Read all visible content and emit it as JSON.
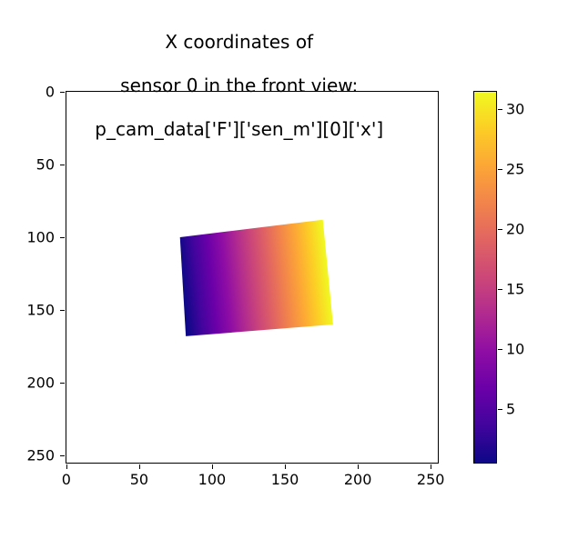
{
  "chart_data": {
    "type": "heatmap",
    "title": "X coordinates of\nsensor 0 in the front view:\np_cam_data['F']['sen_m'][0]['x']",
    "xlabel": "",
    "ylabel": "",
    "x_ticks": [
      0,
      50,
      100,
      150,
      200,
      250
    ],
    "y_ticks": [
      0,
      50,
      100,
      150,
      200,
      250
    ],
    "xlim": [
      -0.5,
      255.5
    ],
    "ylim": [
      255.5,
      -0.5
    ],
    "colorbar": {
      "ticks": [
        5,
        10,
        15,
        20,
        25,
        30
      ],
      "vmin": 0.5,
      "vmax": 31.5,
      "cmap": "viridis"
    },
    "region": {
      "description": "Rotated rectangular region filled with a horizontal gradient (dark purple → yellow) mapping X-coordinate values 0.5..31.5 onto the viridis colormap; rest of image is white (masked/NaN).",
      "quad_vertices_image_xy": [
        [
          78,
          100
        ],
        [
          176,
          88
        ],
        [
          183,
          160
        ],
        [
          82,
          168
        ]
      ],
      "value_gradient_axis": "left→right across the quad",
      "value_range": [
        0.5,
        31.5
      ]
    }
  },
  "title_lines": [
    "X coordinates of",
    "sensor 0 in the front view:",
    "p_cam_data['F']['sen_m'][0]['x']"
  ],
  "viridis_stops": [
    {
      "off": 0.0,
      "c": "#440154"
    },
    {
      "off": 0.1,
      "c": "#482475"
    },
    {
      "off": 0.2,
      "c": "#414487"
    },
    {
      "off": 0.3,
      "c": "#355f8d"
    },
    {
      "off": 0.4,
      "c": "#2a788e"
    },
    {
      "off": 0.5,
      "c": "#21918c"
    },
    {
      "off": 0.6,
      "c": "#22a884"
    },
    {
      "off": 0.7,
      "c": "#44bf70"
    },
    {
      "off": 0.8,
      "c": "#7ad151"
    },
    {
      "off": 0.9,
      "c": "#bddf26"
    },
    {
      "off": 1.0,
      "c": "#fde725"
    }
  ],
  "plasma_stops": [
    {
      "off": 0.0,
      "c": "#0d0887"
    },
    {
      "off": 0.1,
      "c": "#41049d"
    },
    {
      "off": 0.2,
      "c": "#6a00a8"
    },
    {
      "off": 0.3,
      "c": "#8f0da4"
    },
    {
      "off": 0.4,
      "c": "#b12a90"
    },
    {
      "off": 0.5,
      "c": "#cc4778"
    },
    {
      "off": 0.6,
      "c": "#e16462"
    },
    {
      "off": 0.7,
      "c": "#f2844b"
    },
    {
      "off": 0.8,
      "c": "#fca636"
    },
    {
      "off": 0.9,
      "c": "#fcce25"
    },
    {
      "off": 1.0,
      "c": "#f0f921"
    }
  ]
}
